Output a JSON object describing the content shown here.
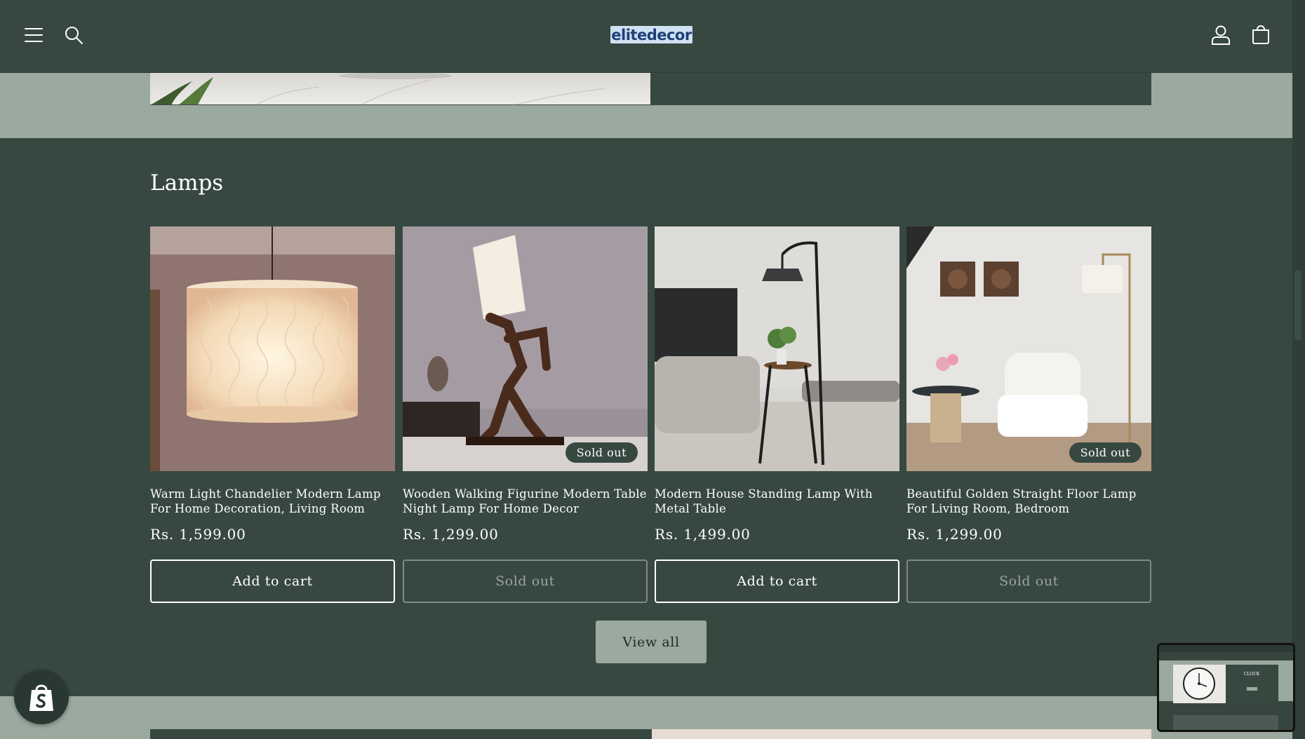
{
  "header": {
    "logo_text": "elitedecor",
    "icons": [
      "menu-icon",
      "search-icon",
      "account-icon",
      "cart-icon"
    ]
  },
  "section": {
    "title": "Lamps"
  },
  "products": [
    {
      "title": "Warm Light Chandelier Modern Lamp For Home Decoration, Living Room",
      "price": "Rs. 1,599.00",
      "button": "Add to cart",
      "badge": "",
      "sold_out": false
    },
    {
      "title": "Wooden Walking Figurine Modern Table Night Lamp For Home Decor",
      "price": "Rs. 1,299.00",
      "button": "Sold out",
      "badge": "Sold out",
      "sold_out": true
    },
    {
      "title": "Modern House Standing Lamp With Metal Table",
      "price": "Rs. 1,499.00",
      "button": "Add to cart",
      "badge": "",
      "sold_out": false
    },
    {
      "title": "Beautiful Golden Straight Floor Lamp For Living Room, Bedroom",
      "price": "Rs. 1,299.00",
      "button": "Sold out",
      "badge": "Sold out",
      "sold_out": true
    }
  ],
  "view_all_label": "View all",
  "thumbnail": {
    "title": "CLOCK"
  },
  "colors": {
    "background": "#374841",
    "accent_sage": "#9aaa9f",
    "text": "#ffffff"
  }
}
